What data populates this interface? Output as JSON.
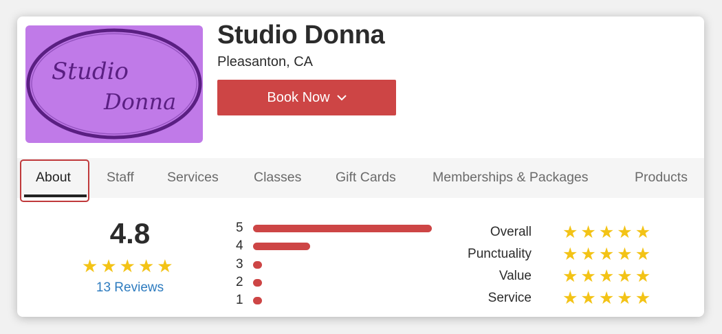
{
  "business": {
    "name": "Studio Donna",
    "location": "Pleasanton, CA",
    "logo_text_line1": "Studio",
    "logo_text_line2": "Donna"
  },
  "book_button": {
    "label": "Book Now",
    "icon": "chevron-down-icon"
  },
  "tabs": [
    {
      "label": "About",
      "active": true
    },
    {
      "label": "Staff"
    },
    {
      "label": "Services"
    },
    {
      "label": "Classes"
    },
    {
      "label": "Gift Cards"
    },
    {
      "label": "Memberships & Packages"
    },
    {
      "label": "Products"
    }
  ],
  "rating": {
    "average": "4.8",
    "stars": 5,
    "reviews_label": "13 Reviews"
  },
  "distribution": [
    {
      "stars": "5",
      "fraction": 1.0
    },
    {
      "stars": "4",
      "fraction": 0.32
    },
    {
      "stars": "3",
      "fraction": 0.0
    },
    {
      "stars": "2",
      "fraction": 0.0
    },
    {
      "stars": "1",
      "fraction": 0.0
    }
  ],
  "categories": [
    {
      "label": "Overall",
      "stars": 5
    },
    {
      "label": "Punctuality",
      "stars": 5
    },
    {
      "label": "Value",
      "stars": 5
    },
    {
      "label": "Service",
      "stars": 5
    }
  ],
  "colors": {
    "accent": "#cd4545",
    "star": "#f3c316",
    "link": "#2d7bbf",
    "logo_bg": "#c07ae8",
    "logo_ink": "#5a1f82"
  }
}
